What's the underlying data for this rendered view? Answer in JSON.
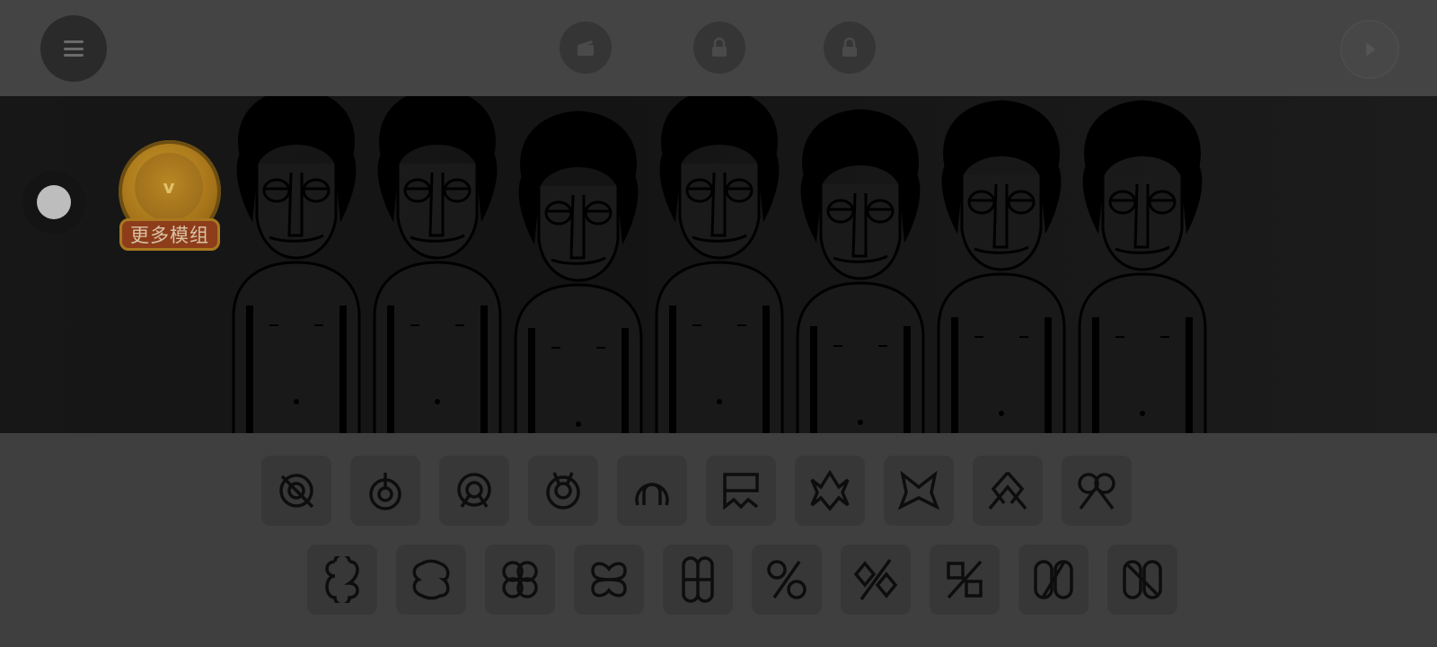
{
  "toolbar": {
    "menu_icon": "hamburger-menu-icon",
    "center_icons": [
      "clapperboard-icon",
      "lock-icon",
      "lock-icon"
    ],
    "play_icon": "play-icon"
  },
  "stage": {
    "characters_count": 7,
    "mod_badge": {
      "icon": "crown-coin-icon",
      "coin_text": "v",
      "label": "更多模组"
    }
  },
  "sound_icons": {
    "row1": [
      "beat-icon-1",
      "beat-icon-2",
      "beat-icon-3",
      "beat-icon-4",
      "beat-icon-5",
      "effect-icon-1",
      "effect-icon-2",
      "effect-icon-3",
      "effect-icon-4",
      "effect-icon-5"
    ],
    "row2": [
      "melody-icon-1",
      "melody-icon-2",
      "melody-icon-3",
      "melody-icon-4",
      "melody-icon-5",
      "voice-icon-1",
      "voice-icon-2",
      "voice-icon-3",
      "voice-icon-4",
      "voice-icon-5"
    ]
  },
  "colors": {
    "overlay": "#3f3f3f",
    "stage": "#171717",
    "badge_gold": "#b88622",
    "badge_label": "#8e3d1a"
  }
}
